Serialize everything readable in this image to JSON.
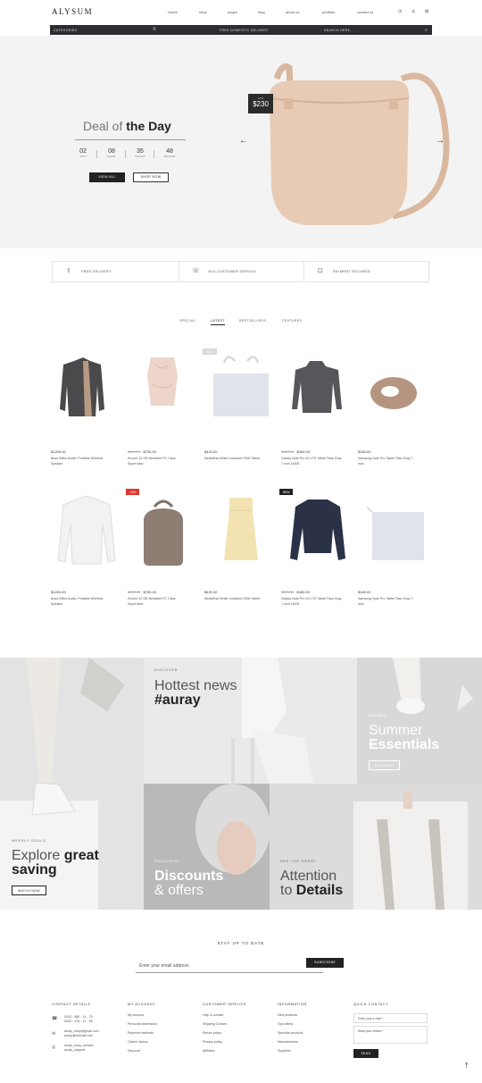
{
  "brand": "ALYSUM",
  "nav": [
    "Home",
    "shop",
    "pages",
    "blog",
    "about us",
    "portfolio",
    "contact us"
  ],
  "header_icons": [
    "clock-icon",
    "user-icon",
    "cart-icon"
  ],
  "catbar": {
    "categories": "CATEGORIES",
    "delivery": "FREE DOMESTIC DELIVERY",
    "search_placeholder": "SEARCH HERE..."
  },
  "hero": {
    "title_light": "Deal of",
    "title_bold": "the Day",
    "countdown": [
      {
        "value": "02",
        "label": "DAYS"
      },
      {
        "value": "08",
        "label": "HOURS"
      },
      {
        "value": "35",
        "label": "MINUTES"
      },
      {
        "value": "48",
        "label": "SECONDS"
      }
    ],
    "btn_view_all": "VIEW ALL",
    "btn_shop_now": "SHOP NOW",
    "old_price": "$268",
    "price": "$230"
  },
  "services": [
    "FREE DELIVERY",
    "24/4 CUSTOMER SERVICE",
    "PAYMENT SECURED"
  ],
  "tabs": [
    "SPECIAL",
    "LATEST",
    "BESTSELLERS",
    "FEATURES"
  ],
  "products_row1": [
    {
      "old": "",
      "price": "$1200.00",
      "name": "Bose Effect Audio: Portable Wireless Speaker",
      "badge": ""
    },
    {
      "old": "$800.00",
      "price": "$700.00",
      "name": "Encore 32 GB Nertablet PC Clear SuperView",
      "badge": ""
    },
    {
      "old": "",
      "price": "$420.00",
      "name": "MediaPad White Unlocked GSM Tablet",
      "badge": "SALE"
    },
    {
      "old": "$520.00",
      "price": "$400.00",
      "name": "Galaxy Note Pro 4G LTE Tablet Titan Gray 7-inch 16GB",
      "badge": ""
    },
    {
      "old": "",
      "price": "$160.00",
      "name": "Samsung Note Pro Tablet Titan Gray 7-inch",
      "badge": ""
    }
  ],
  "products_row2": [
    {
      "old": "",
      "price": "$1200.00",
      "name": "Bose Effect Audio: Portable Wireless Speaker",
      "badge": ""
    },
    {
      "old": "$800.00",
      "price": "$750.00",
      "name": "Encore 32 GB Nertablet PC Clear SuperView",
      "badge": "-20%"
    },
    {
      "old": "",
      "price": "$420.00",
      "name": "MediaPad White Unlocked GSM Tablet",
      "badge": ""
    },
    {
      "old": "$520.00",
      "price": "$400.00",
      "name": "Galaxy Note Pro 4G LTE Tablet Titan Gray 7-inch 16GB",
      "badge": "NEW"
    },
    {
      "old": "",
      "price": "$160.00",
      "name": "Samsung Note Pro Tablet Titan Gray 7-inch",
      "badge": ""
    }
  ],
  "banners": {
    "weekly": {
      "kicker": "WEEKLY DEALS",
      "light": "Explore",
      "bold1": "great",
      "bold2": "saving",
      "button": "WATCH NOW"
    },
    "news": {
      "kicker": "DISCOVER",
      "light": "Hottest news",
      "bold": "#auray"
    },
    "summer": {
      "kicker": "DIVIDED",
      "light": "Summer",
      "bold": "Essentials",
      "button": "DISCOVER"
    },
    "discounts": {
      "kicker": "EXCLUSIVE",
      "bold": "Discounts",
      "light": "& offers"
    },
    "attention": {
      "kicker": "SEE THE GREAT",
      "light": "Attention",
      "to": "to",
      "bold": "Details"
    }
  },
  "newsletter": {
    "title": "STAY UP TO DATE",
    "placeholder": "Enter your email address",
    "button": "SUBSCRIBE"
  },
  "footer": {
    "contact": {
      "title": "CONTACT DETAILS",
      "phone1": "0203 - 980 - 14 - 78",
      "phone2": "0203 - 478 - 12 - 96",
      "email1": "auray_shop@gmail.com",
      "email2": "auray@hotmail.com",
      "skype1": "auray_shop_contact",
      "skype2": "auray_support"
    },
    "account": {
      "title": "MY ACCOUNT",
      "links": [
        "My account",
        "Personal information",
        "Payment methods",
        "Orders history",
        "Discount"
      ]
    },
    "service": {
      "title": "CUSTOMER SERVICE",
      "links": [
        "Help & contact",
        "Shipping & taxes",
        "Return policy",
        "Privacy policy",
        "Affiliates"
      ]
    },
    "information": {
      "title": "INFORMATION",
      "links": [
        "New products",
        "Top sellers",
        "Specials products",
        "Manufacturers",
        "Suppliers"
      ]
    },
    "quick": {
      "title": "QUICK CONTACT",
      "email_placeholder": "Enter your e-mail *",
      "review_placeholder": "Write your review *",
      "send": "SEND"
    }
  }
}
